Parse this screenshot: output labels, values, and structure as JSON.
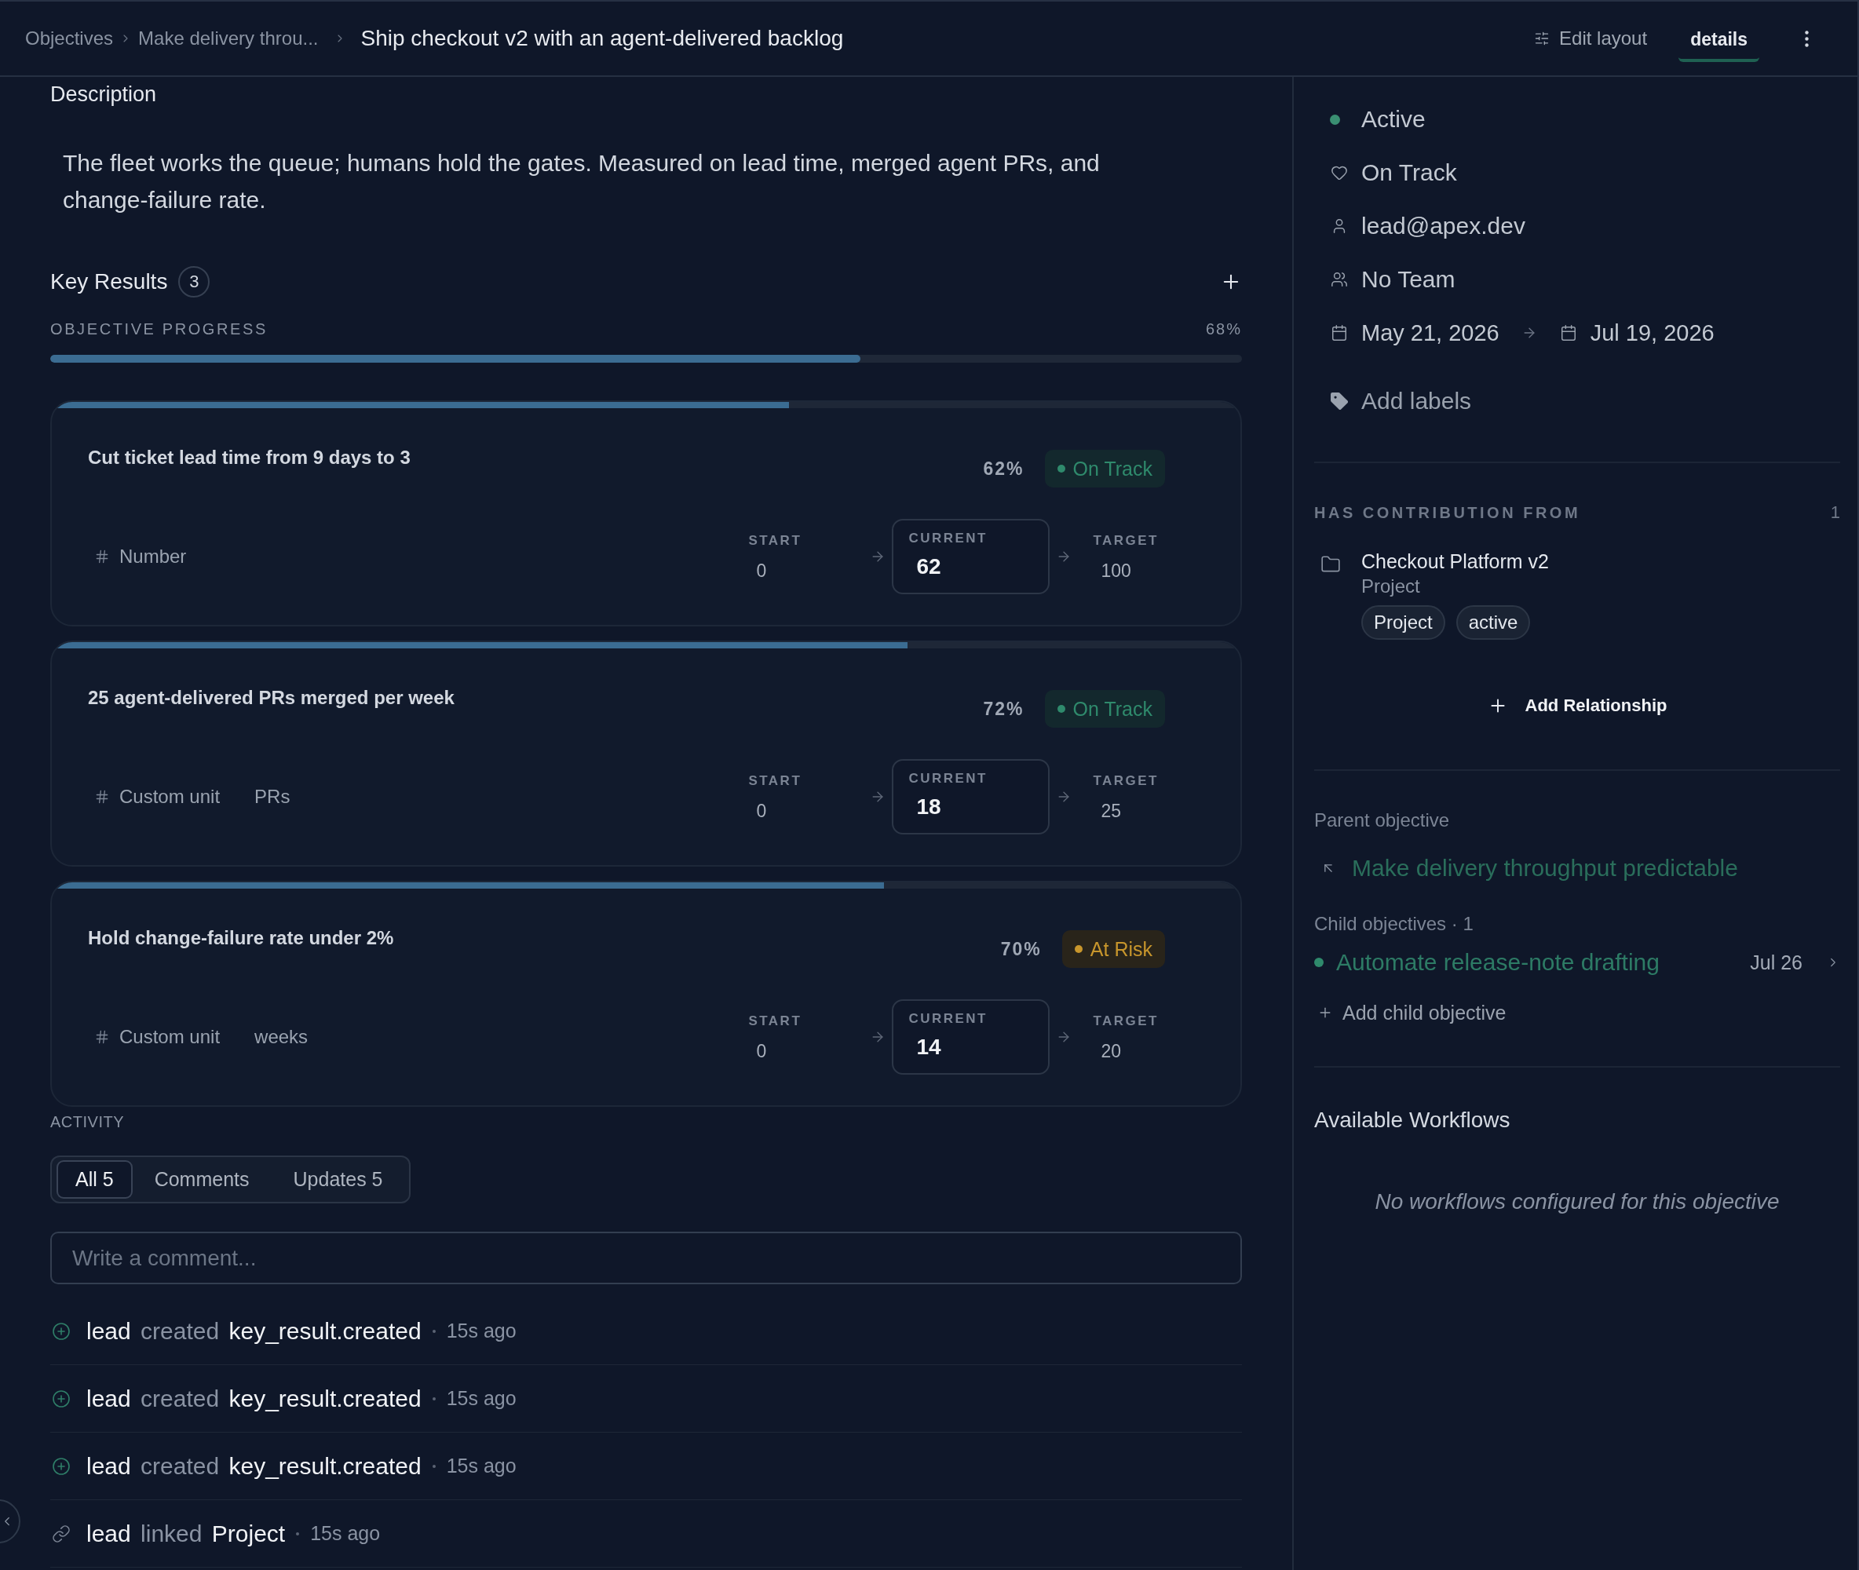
{
  "header": {
    "breadcrumb": [
      "Objectives",
      "Make delivery throu..."
    ],
    "title": "Ship checkout v2 with an agent-delivered backlog",
    "edit_layout": "Edit layout",
    "view_tabs": [
      {
        "label": "details",
        "selected": true
      }
    ]
  },
  "description": {
    "heading": "Description",
    "text": "The fleet works the queue; humans hold the gates. Measured on lead time, merged agent PRs, and change-failure rate."
  },
  "key_results": {
    "title": "Key Results",
    "count": "3",
    "progress": {
      "label": "OBJECTIVE PROGRESS",
      "reading": "68%",
      "level": 0.68
    },
    "items": [
      {
        "title": "Cut ticket lead time from 9 days to 3",
        "level": 0.62,
        "reading": "62%",
        "status": {
          "kind": "on_track",
          "label": "On Track"
        },
        "unit_type": "Number",
        "start_label": "START",
        "start": "0",
        "current_label": "CURRENT",
        "current": "62",
        "target_label": "TARGET",
        "target": "100"
      },
      {
        "title": "25 agent-delivered PRs merged per week",
        "level": 0.72,
        "reading": "72%",
        "status": {
          "kind": "on_track",
          "label": "On Track"
        },
        "unit_type": "Custom unit",
        "unit": "PRs",
        "start_label": "START",
        "start": "0",
        "current_label": "CURRENT",
        "current": "18",
        "target_label": "TARGET",
        "target": "25"
      },
      {
        "title": "Hold change-failure rate under 2%",
        "level": 0.7,
        "reading": "70%",
        "status": {
          "kind": "at_risk",
          "label": "At Risk"
        },
        "unit_type": "Custom unit",
        "unit": "weeks",
        "start_label": "START",
        "start": "0",
        "current_label": "CURRENT",
        "current": "14",
        "target_label": "TARGET",
        "target": "20"
      }
    ]
  },
  "activity": {
    "heading": "ACTIVITY",
    "tabs": [
      {
        "label": "All 5",
        "selected": true
      },
      {
        "label": "Comments",
        "selected": false
      },
      {
        "label": "Updates 5",
        "selected": false
      }
    ],
    "comment_placeholder": "Write a comment...",
    "entries": [
      {
        "kind": "created",
        "actor": "lead",
        "verb": "created",
        "object": "key_result.created",
        "time": "15s ago"
      },
      {
        "kind": "created",
        "actor": "lead",
        "verb": "created",
        "object": "key_result.created",
        "time": "15s ago"
      },
      {
        "kind": "created",
        "actor": "lead",
        "verb": "created",
        "object": "key_result.created",
        "time": "15s ago"
      },
      {
        "kind": "linked",
        "actor": "lead",
        "verb": "linked",
        "object": "Project",
        "time": "15s ago"
      }
    ]
  },
  "details": {
    "status": "Active",
    "health": "On Track",
    "owner": "lead@apex.dev",
    "team": "No Team",
    "start_date": "May 21, 2026",
    "end_date": "Jul 19, 2026",
    "labels_action": "Add labels"
  },
  "contributions": {
    "heading": "HAS CONTRIBUTION FROM",
    "count": "1",
    "items": [
      {
        "name": "Checkout Platform v2",
        "type": "Project",
        "tags": [
          "Project",
          "active"
        ]
      }
    ],
    "add_action": "Add Relationship"
  },
  "parent_objective": {
    "heading": "Parent objective",
    "title": "Make delivery throughput predictable"
  },
  "child_objectives": {
    "heading": "Child objectives · 1",
    "items": [
      {
        "title": "Automate release-note drafting",
        "date": "Jul 26"
      }
    ],
    "add_action": "Add child objective"
  },
  "workflows": {
    "heading": "Available Workflows",
    "empty": "No workflows configured for this objective"
  }
}
